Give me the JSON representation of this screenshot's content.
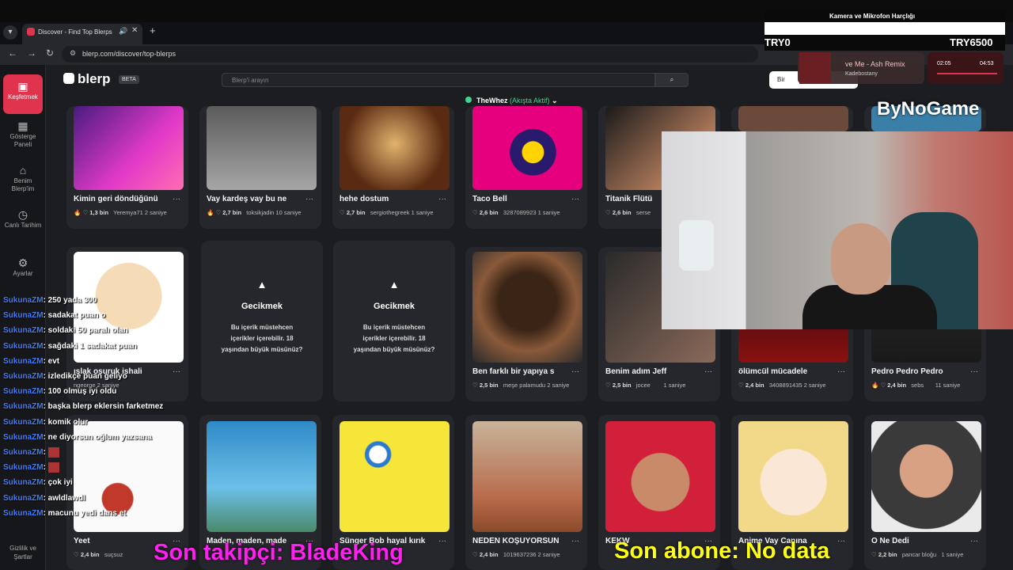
{
  "browser": {
    "tab_title": "Discover - Find Top Blerps",
    "url": "blerp.com/discover/top-blerps"
  },
  "sidebar": {
    "items": [
      {
        "label": "Keşfetmek",
        "icon": "discover-icon"
      },
      {
        "label": "Gösterge Paneli",
        "icon": "dashboard-icon"
      },
      {
        "label": "Benim Blerp'im",
        "icon": "home-icon"
      },
      {
        "label": "Canlı Tarihim",
        "icon": "history-icon"
      },
      {
        "label": "Ayarlar",
        "icon": "gear-icon"
      }
    ],
    "footer": "Gizlilik ve Şartlar"
  },
  "header": {
    "brand": "blerp",
    "beta": "BETA",
    "search_placeholder": "Blerp'i arayın",
    "user_button": "Bir",
    "status_user": "TheWhez",
    "status_text": "(Akışta Aktif)"
  },
  "cards_row1": [
    {
      "title": "Kimin geri döndüğünü",
      "likes": "1,3 bin",
      "author": "Yeremya71",
      "time": "2 saniye",
      "fire": true
    },
    {
      "title": "Vay kardeş vay bu ne",
      "likes": "2,7 bin",
      "author": "toksikjadin",
      "time": "10 saniye",
      "fire": true
    },
    {
      "title": "hehe dostum",
      "likes": "2,7 bin",
      "author": "sergiothegreek",
      "time": "1 saniye",
      "fire": false
    },
    {
      "title": "Taco Bell",
      "likes": "2,6 bin",
      "author": "3287089923",
      "time": "1 saniye",
      "fire": false
    },
    {
      "title": "Titanik Flütü",
      "likes": "2,6 bin",
      "author": "serse",
      "time": "",
      "fire": false
    }
  ],
  "cards_row2": [
    {
      "title": "ıslak osuruk ishali",
      "likes": "",
      "author": "ngeorge",
      "time": "2 saniye",
      "fire": false
    },
    {
      "title": "Ben farklı bir yapıya s",
      "likes": "2,5 bin",
      "author": "meşe palamudu",
      "time": "2 saniye",
      "fire": false
    },
    {
      "title": "Benim adım Jeff",
      "likes": "2,5 bin",
      "author": "jocee",
      "time": "1 saniye",
      "fire": false
    },
    {
      "title": "ölümcül mücadele",
      "likes": "2,4 bin",
      "author": "3408891435",
      "time": "2 saniye",
      "fire": false
    },
    {
      "title": "Pedro Pedro Pedro",
      "likes": "2,4 bin",
      "author": "sebs",
      "time": "11 saniye",
      "fire": true
    }
  ],
  "warning": {
    "title": "Gecikmek",
    "text": "Bu içerik müstehcen içerikler içerebilir. 18 yaşından büyük müsünüz?"
  },
  "cards_row3": [
    {
      "title": "Yeet",
      "likes": "2,4 bin",
      "author": "suçsuz",
      "time": ""
    },
    {
      "title": "Maden, maden, made",
      "likes": "",
      "author": "",
      "time": ""
    },
    {
      "title": "Sünger Bob hayal kırık",
      "likes": "",
      "author": "",
      "time": ""
    },
    {
      "title": "NEDEN KOŞUYORSUN",
      "likes": "2,4 bin",
      "author": "1019637236",
      "time": "2 saniye"
    },
    {
      "title": "KEKW",
      "likes": "",
      "author": "",
      "time": ""
    },
    {
      "title": "Anime Vay Canına",
      "likes": "",
      "author": "",
      "time": ""
    },
    {
      "title": "O Ne Dedi",
      "likes": "2,2 bin",
      "author": "pancar bloğu",
      "time": "1 saniye"
    }
  ],
  "overlay": {
    "title": "Kamera ve Mikrofon Harçlığı",
    "left": "TRY0",
    "right": "TRY6500",
    "music_title": "ve Me - Ash Remix",
    "music_artist": "Kadebostany",
    "time_current": "02:05",
    "time_total": "04:53",
    "brand": "ByNoGame",
    "follower": "Son takipçi: BladeKing",
    "subscriber": "Son abone: No data"
  },
  "chat": [
    {
      "name": "SukunaZM",
      "msg": ": 250 yada 300"
    },
    {
      "name": "SukunaZM",
      "msg": ": sadakat puan o"
    },
    {
      "name": "SukunaZM",
      "msg": ": soldaki 50 paralı olan"
    },
    {
      "name": "SukunaZM",
      "msg": ": sağdaki 1 sadakat puan"
    },
    {
      "name": "SukunaZM",
      "msg": ": evt"
    },
    {
      "name": "SukunaZM",
      "msg": ": izledikçe puan geliyo"
    },
    {
      "name": "SukunaZM",
      "msg": ": 100 olmuş iyi oldu"
    },
    {
      "name": "SukunaZM",
      "msg": ": başka blerp eklersin farketmez"
    },
    {
      "name": "SukunaZM",
      "msg": ": komik olur"
    },
    {
      "name": "SukunaZM",
      "msg": ": ne diyorsun oğlum yazsana"
    },
    {
      "name": "SukunaZM",
      "msg": ":"
    },
    {
      "name": "SukunaZM",
      "msg": ":"
    },
    {
      "name": "SukunaZM",
      "msg": ": çok iyi"
    },
    {
      "name": "SukunaZM",
      "msg": ": awldlawdl"
    },
    {
      "name": "SukunaZM",
      "msg": ": macunu yedi dans et"
    }
  ]
}
